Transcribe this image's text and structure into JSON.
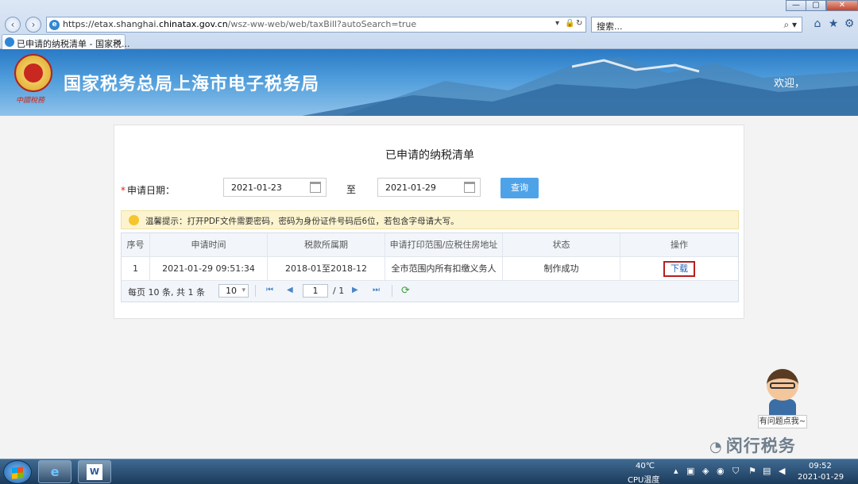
{
  "browser": {
    "url_scheme": "https://",
    "url_pre": "etax.shanghai.",
    "url_domain": "chinatax.gov.cn",
    "url_tail": "/wsz-ww-web/web/taxBill?autoSearch=true",
    "search_placeholder": "搜索...",
    "tab_title": "已申请的纳税清单 - 国家税...",
    "tab_close": "×",
    "back_icon": "‹",
    "forward_icon": "›"
  },
  "header": {
    "site_title": "国家税务总局上海市电子税务局",
    "welcome": "欢迎，",
    "emblem_sign": "中國稅務"
  },
  "page": {
    "title": "已申请的纳税清单",
    "date_required_mark": "*",
    "date_label": "申请日期：",
    "date_from": "2021-01-23",
    "date_to_label": "至",
    "date_to": "2021-01-29",
    "query_button": "查询",
    "tip": "温馨提示：打开PDF文件需要密码，密码为身份证件号码后6位，若包含字母请大写。"
  },
  "table": {
    "headers": [
      "序号",
      "申请时间",
      "税款所属期",
      "申请打印范围/应税住房地址",
      "状态",
      "操作"
    ],
    "rows": [
      {
        "index": "1",
        "time": "2021-01-29 09:51:34",
        "period": "2018-01至2018-12",
        "scope": "全市范围内所有扣缴义务人",
        "status": "制作成功",
        "action": "下载"
      }
    ]
  },
  "pager": {
    "summary": "每页 10 条, 共 1 条",
    "page_size": "10",
    "current_page": "1",
    "total_pages": "/ 1"
  },
  "helper": {
    "bubble": "有问题点我~"
  },
  "watermark": "闵行税务",
  "taskbar": {
    "temp": "40℃",
    "temp_label": "CPU温度",
    "time": "09:52",
    "date": "2021-01-29"
  },
  "colors": {
    "header_blue": "#2a7ac6",
    "query_button": "#4ea3e8",
    "download_border": "#b81f1f",
    "tip_background": "#fcf3cf"
  }
}
